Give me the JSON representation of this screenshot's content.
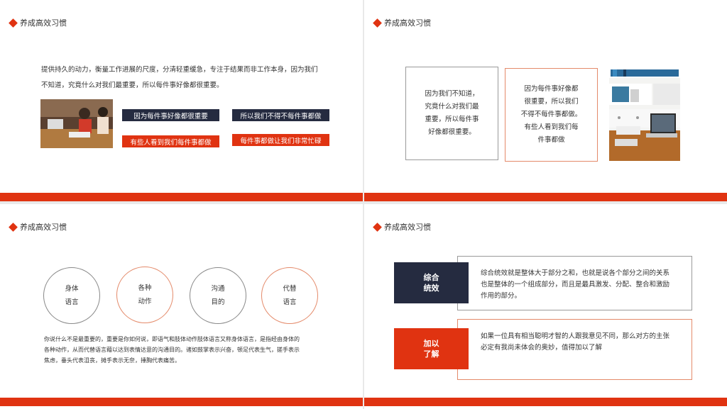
{
  "slide1": {
    "title": "养成高效习惯",
    "paragraph_line1": "提供持久的动力，衡量工作进展的尺度，分清轻重缓急，专注于结果而非工作本身，因为我们",
    "paragraph_line2": "不知道，究竟什么对我们最重要，所以每件事好像都很重要。",
    "tags": [
      "因为每件事好像都很重要",
      "所以我们不得不每件事都做",
      "有些人看到我们每件事都做",
      "每件事都做让我们非常忙碌"
    ]
  },
  "slide2": {
    "title": "养成高效习惯",
    "box1_lines": [
      "因为我们不知道，",
      "究竟什么对我们最",
      "重要，所以每件事",
      "好像都很重要。"
    ],
    "box2_lines": [
      "因为每件事好像都",
      "很重要，所以我们",
      "不得不每件事都做。",
      "有些人看到我们每",
      "件事都做"
    ]
  },
  "slide3": {
    "title": "养成高效习惯",
    "circles": [
      [
        "身体",
        "语言"
      ],
      [
        "各种",
        "动作"
      ],
      [
        "沟通",
        "目的"
      ],
      [
        "代替",
        "语言"
      ]
    ],
    "paragraph_lines": [
      "你说什么不是最重要的，重要是你如何说，即语气和肢体动作肢体语言又称身体语言，是指经由身体的",
      "各种动作，从而代替语言藉以达到表情达意的沟通目的。诸如鼓掌表示兴奋，顿足代表生气，搓手表示",
      "焦虑，垂头代表沮丧，摊手表示无奈，捶胸代表痛苦。"
    ]
  },
  "slide4": {
    "title": "养成高效习惯",
    "block1_label": [
      "综合",
      "统效"
    ],
    "block1_text": [
      "综合统效就是整体大于部分之和，也就是说各个部分之间的关系",
      "也是整体的一个组成部分，而且是最具激发、分配、整合和激励",
      "作用的部分。"
    ],
    "block2_label": [
      "加以",
      "了解"
    ],
    "block2_text": [
      "如果一位具有相当聪明才智的人跟我意见不同，那么对方的主张",
      "必定有我尚未体会的奥妙，值得加以了解"
    ]
  },
  "colors": {
    "accent": "#e03311",
    "dark": "#252b40"
  }
}
